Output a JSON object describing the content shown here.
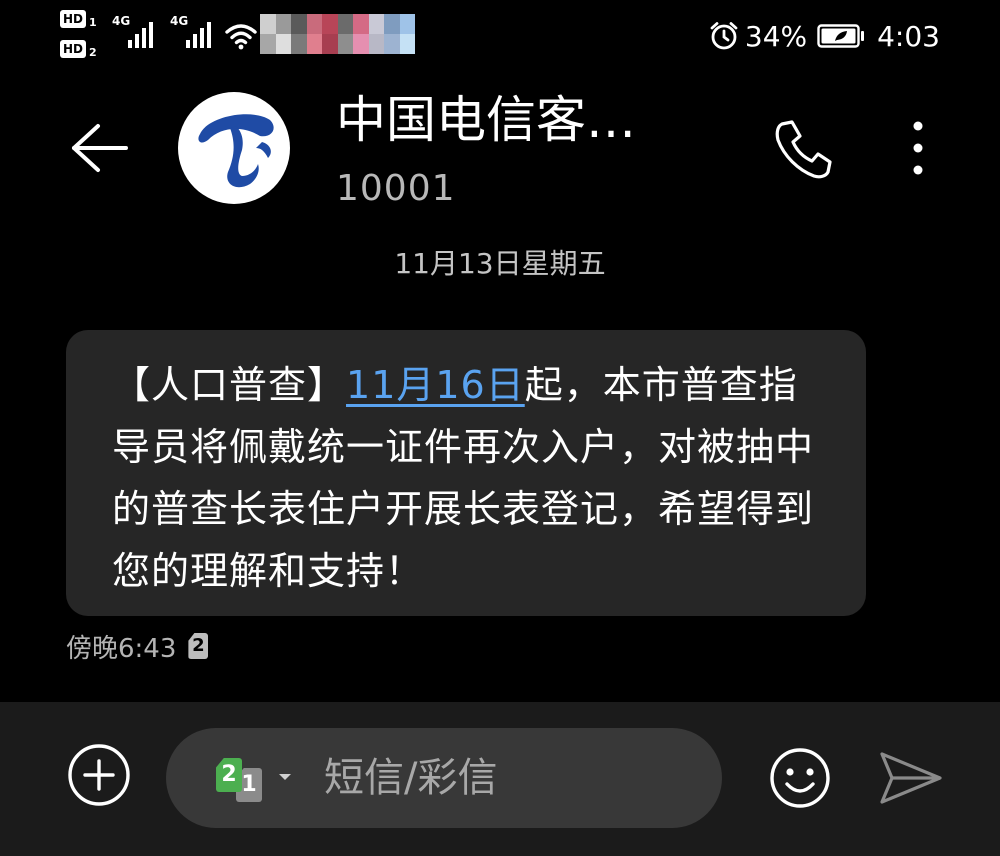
{
  "status_bar": {
    "sim1_badge": "HD",
    "sim1_slot": "1",
    "sim2_badge": "HD",
    "sim2_slot": "2",
    "network_1": "4G",
    "network_2": "4G",
    "battery_percent": "34%",
    "time": "4:03",
    "icons": [
      "alarm-icon",
      "battery-icon",
      "wifi-icon",
      "signal-icon"
    ]
  },
  "header": {
    "contact_name": "中国电信客…",
    "contact_number": "10001",
    "icons": [
      "back-arrow-icon",
      "china-telecom-logo",
      "phone-icon",
      "more-vertical-icon"
    ],
    "brand_color": "#1f4ba5"
  },
  "conversation": {
    "date_divider": "11月13日星期五",
    "message": {
      "prefix": "【人口普查】",
      "link_text": "11月16日",
      "body": "起，本市普查指导员将佩戴统一证件再次入户，对被抽中的普查长表住户开展长表登记，希望得到您的理解和支持！",
      "time": "傍晚6:43",
      "sim_slot": "2",
      "link_color": "#5aa3f0"
    }
  },
  "composer": {
    "placeholder": "短信/彩信",
    "sim_front": "2",
    "sim_back": "1",
    "sim_front_color": "#4caf50",
    "icons": [
      "add-icon",
      "chevron-down-icon",
      "emoji-icon",
      "send-icon"
    ]
  }
}
